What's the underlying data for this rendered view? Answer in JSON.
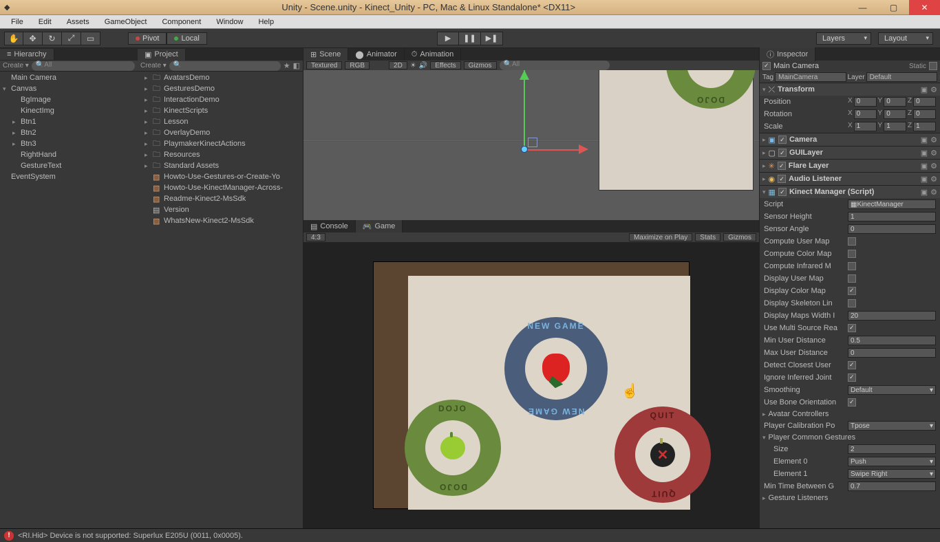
{
  "window": {
    "app_icon": "◆",
    "title": "Unity - Scene.unity - Kinect_Unity - PC, Mac & Linux Standalone* <DX11>"
  },
  "menu": [
    "File",
    "Edit",
    "Assets",
    "GameObject",
    "Component",
    "Window",
    "Help"
  ],
  "toolbar": {
    "pivot": "Pivot",
    "local": "Local",
    "layers": "Layers",
    "layout": "Layout"
  },
  "hierarchy": {
    "title": "Hierarchy",
    "create": "Create",
    "search_placeholder": "All",
    "items": [
      {
        "name": "Main Camera",
        "indent": 0,
        "arrow": ""
      },
      {
        "name": "Canvas",
        "indent": 0,
        "arrow": "▾"
      },
      {
        "name": "BgImage",
        "indent": 1,
        "arrow": ""
      },
      {
        "name": "KinectImg",
        "indent": 1,
        "arrow": ""
      },
      {
        "name": "Btn1",
        "indent": 1,
        "arrow": "▸"
      },
      {
        "name": "Btn2",
        "indent": 1,
        "arrow": "▸"
      },
      {
        "name": "Btn3",
        "indent": 1,
        "arrow": "▸"
      },
      {
        "name": "RightHand",
        "indent": 1,
        "arrow": ""
      },
      {
        "name": "GestureText",
        "indent": 1,
        "arrow": ""
      },
      {
        "name": "EventSystem",
        "indent": 0,
        "arrow": ""
      }
    ]
  },
  "project": {
    "title": "Project",
    "create": "Create",
    "items": [
      {
        "name": "AvatarsDemo",
        "type": "folder"
      },
      {
        "name": "GesturesDemo",
        "type": "folder"
      },
      {
        "name": "InteractionDemo",
        "type": "folder"
      },
      {
        "name": "KinectScripts",
        "type": "folder"
      },
      {
        "name": "Lesson",
        "type": "folder"
      },
      {
        "name": "OverlayDemo",
        "type": "folder"
      },
      {
        "name": "PlaymakerKinectActions",
        "type": "folder"
      },
      {
        "name": "Resources",
        "type": "folder"
      },
      {
        "name": "Standard Assets",
        "type": "folder"
      },
      {
        "name": "Howto-Use-Gestures-or-Create-Yo",
        "type": "doc"
      },
      {
        "name": "Howto-Use-KinectManager-Across-",
        "type": "doc"
      },
      {
        "name": "Readme-Kinect2-MsSdk",
        "type": "doc"
      },
      {
        "name": "Version",
        "type": "text"
      },
      {
        "name": "WhatsNew-Kinect2-MsSdk",
        "type": "doc"
      }
    ]
  },
  "scene": {
    "tabs": [
      "Scene",
      "Animator",
      "Animation"
    ],
    "shading": "Textured",
    "rgb": "RGB",
    "twod": "2D",
    "effects": "Effects",
    "gizmos": "Gizmos",
    "search": "All"
  },
  "game": {
    "tabs": [
      "Console",
      "Game"
    ],
    "aspect": "4:3",
    "maximize": "Maximize on Play",
    "stats": "Stats",
    "gizmos": "Gizmos",
    "ring_newgame": "NEW GAME",
    "ring_dojo": "DOJO",
    "ring_quit": "QUIT"
  },
  "inspector": {
    "title": "Inspector",
    "object_name": "Main Camera",
    "static": "Static",
    "tag_label": "Tag",
    "tag_value": "MainCamera",
    "layer_label": "Layer",
    "layer_value": "Default",
    "transform": {
      "title": "Transform",
      "position": "Position",
      "rotation": "Rotation",
      "scale": "Scale",
      "px": "0",
      "py": "0",
      "pz": "0",
      "rx": "0",
      "ry": "0",
      "rz": "0",
      "sx": "1",
      "sy": "1",
      "sz": "1"
    },
    "components": [
      {
        "name": "Camera",
        "checkedIcon": true
      },
      {
        "name": "GUILayer",
        "checkedIcon": true
      },
      {
        "name": "Flare Layer",
        "checkedIcon": true
      },
      {
        "name": "Audio Listener",
        "checkedIcon": true
      }
    ],
    "script": {
      "title": "Kinect Manager (Script)",
      "script_label": "Script",
      "script_value": "KinectManager",
      "rows": [
        {
          "label": "Sensor Height",
          "value": "1"
        },
        {
          "label": "Sensor Angle",
          "value": "0"
        },
        {
          "label": "Compute User Map",
          "check": false
        },
        {
          "label": "Compute Color Map",
          "check": false
        },
        {
          "label": "Compute Infrared M",
          "check": false
        },
        {
          "label": "Display User Map",
          "check": false
        },
        {
          "label": "Display Color Map",
          "check": true
        },
        {
          "label": "Display Skeleton Lin",
          "check": false
        },
        {
          "label": "Display Maps Width I",
          "value": "20"
        },
        {
          "label": "Use Multi Source Rea",
          "check": true
        },
        {
          "label": "Min User Distance",
          "value": "0.5"
        },
        {
          "label": "Max User Distance",
          "value": "0"
        },
        {
          "label": "Detect Closest User",
          "check": true
        },
        {
          "label": "Ignore Inferred Joint",
          "check": true
        },
        {
          "label": "Smoothing",
          "dropdown": "Default"
        },
        {
          "label": "Use Bone Orientation",
          "check": true
        }
      ],
      "avatar": "Avatar Controllers",
      "calib_label": "Player Calibration Po",
      "calib_value": "Tpose",
      "gestures": "Player Common Gestures",
      "size_label": "Size",
      "size_value": "2",
      "el0_label": "Element 0",
      "el0_value": "Push",
      "el1_label": "Element 1",
      "el1_value": "Swipe Right",
      "mintime_label": "Min Time Between G",
      "mintime_value": "0.7",
      "listeners": "Gesture Listeners"
    }
  },
  "status": {
    "msg": "<RI.Hid> Device is not supported: Superlux E205U (0011, 0x0005)."
  }
}
